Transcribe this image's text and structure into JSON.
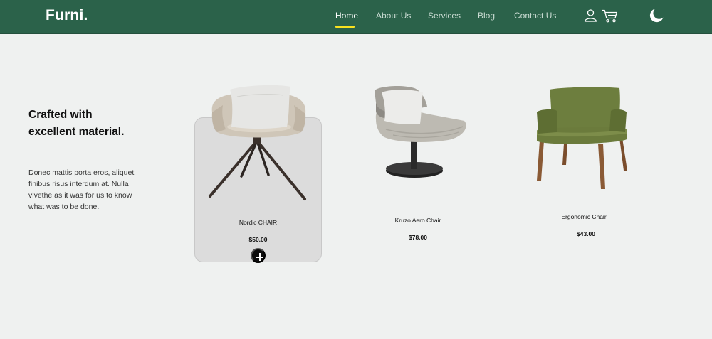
{
  "brand": {
    "name": "Furni."
  },
  "nav": {
    "items": [
      {
        "label": "Home",
        "active": true
      },
      {
        "label": "About Us"
      },
      {
        "label": "Services"
      },
      {
        "label": "Blog"
      },
      {
        "label": "Contact Us"
      }
    ],
    "icons": [
      "user-icon",
      "cart-icon",
      "moon-icon"
    ]
  },
  "intro": {
    "title": "Crafted with excellent material.",
    "text": "Donec mattis porta eros, aliquet finibus risus interdum at. Nulla vivethe as it was for us to know what was to be done."
  },
  "products": [
    {
      "name": "Nordic CHAIR",
      "price": "$50.00",
      "highlighted": true
    },
    {
      "name": "Kruzo Aero Chair",
      "price": "$78.00"
    },
    {
      "name": "Ergonomic Chair",
      "price": "$43.00"
    }
  ],
  "colors": {
    "nav_bg": "#2b624a",
    "accent": "#f9e21f",
    "page_bg": "#eff1f0",
    "card_bg": "#dcdcdc"
  }
}
